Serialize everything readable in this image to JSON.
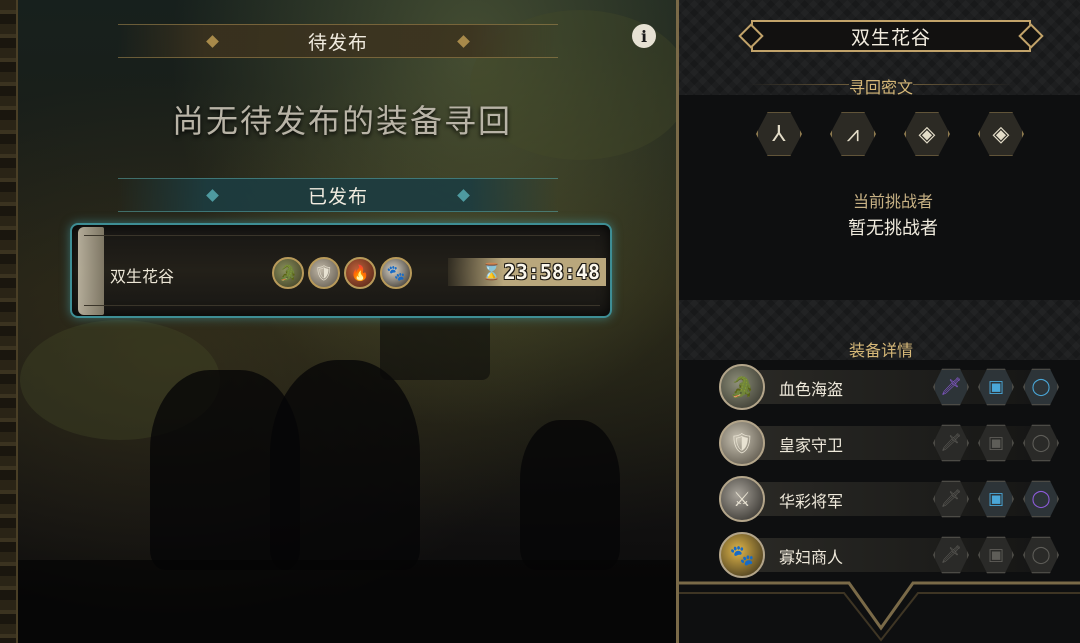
{
  "left": {
    "pending_header": "待发布",
    "empty_message": "尚无待发布的装备寻回",
    "published_header": "已发布",
    "info_icon": "info-icon",
    "published_item": {
      "map_name": "双生花谷",
      "timer": "23:58:48",
      "portraits": [
        "crocodile-portrait-icon",
        "knight-portrait-icon",
        "red-warrior-portrait-icon",
        "widow-portrait-icon"
      ]
    }
  },
  "right": {
    "map_title": "双生花谷",
    "cipher_title": "寻回密文",
    "runes": [
      "rune-1-icon",
      "rune-2-icon",
      "rune-3-icon",
      "rune-4-icon"
    ],
    "challenger_title": "当前挑战者",
    "challenger_value": "暂无挑战者",
    "equipment_title": "装备详情",
    "heroes": [
      {
        "name": "血色海盗",
        "avatar": "crocodile-avatar-icon",
        "slots": {
          "weapon": "purple",
          "armor": "blue",
          "ring": "blue"
        }
      },
      {
        "name": "皇家守卫",
        "avatar": "knight-avatar-icon",
        "slots": {
          "weapon": "empty",
          "armor": "empty",
          "ring": "empty"
        }
      },
      {
        "name": "华彩将军",
        "avatar": "general-avatar-icon",
        "slots": {
          "weapon": "empty",
          "armor": "blue",
          "ring": "purple"
        }
      },
      {
        "name": "寡妇商人",
        "avatar": "widow-avatar-icon",
        "slots": {
          "weapon": "empty",
          "armor": "empty",
          "ring": "empty"
        }
      }
    ]
  },
  "colors": {
    "gold": "#c2a36a",
    "teal_glow": "#3e8e95",
    "purple_item": "#8d5bd9",
    "blue_item": "#4aa7d8"
  }
}
